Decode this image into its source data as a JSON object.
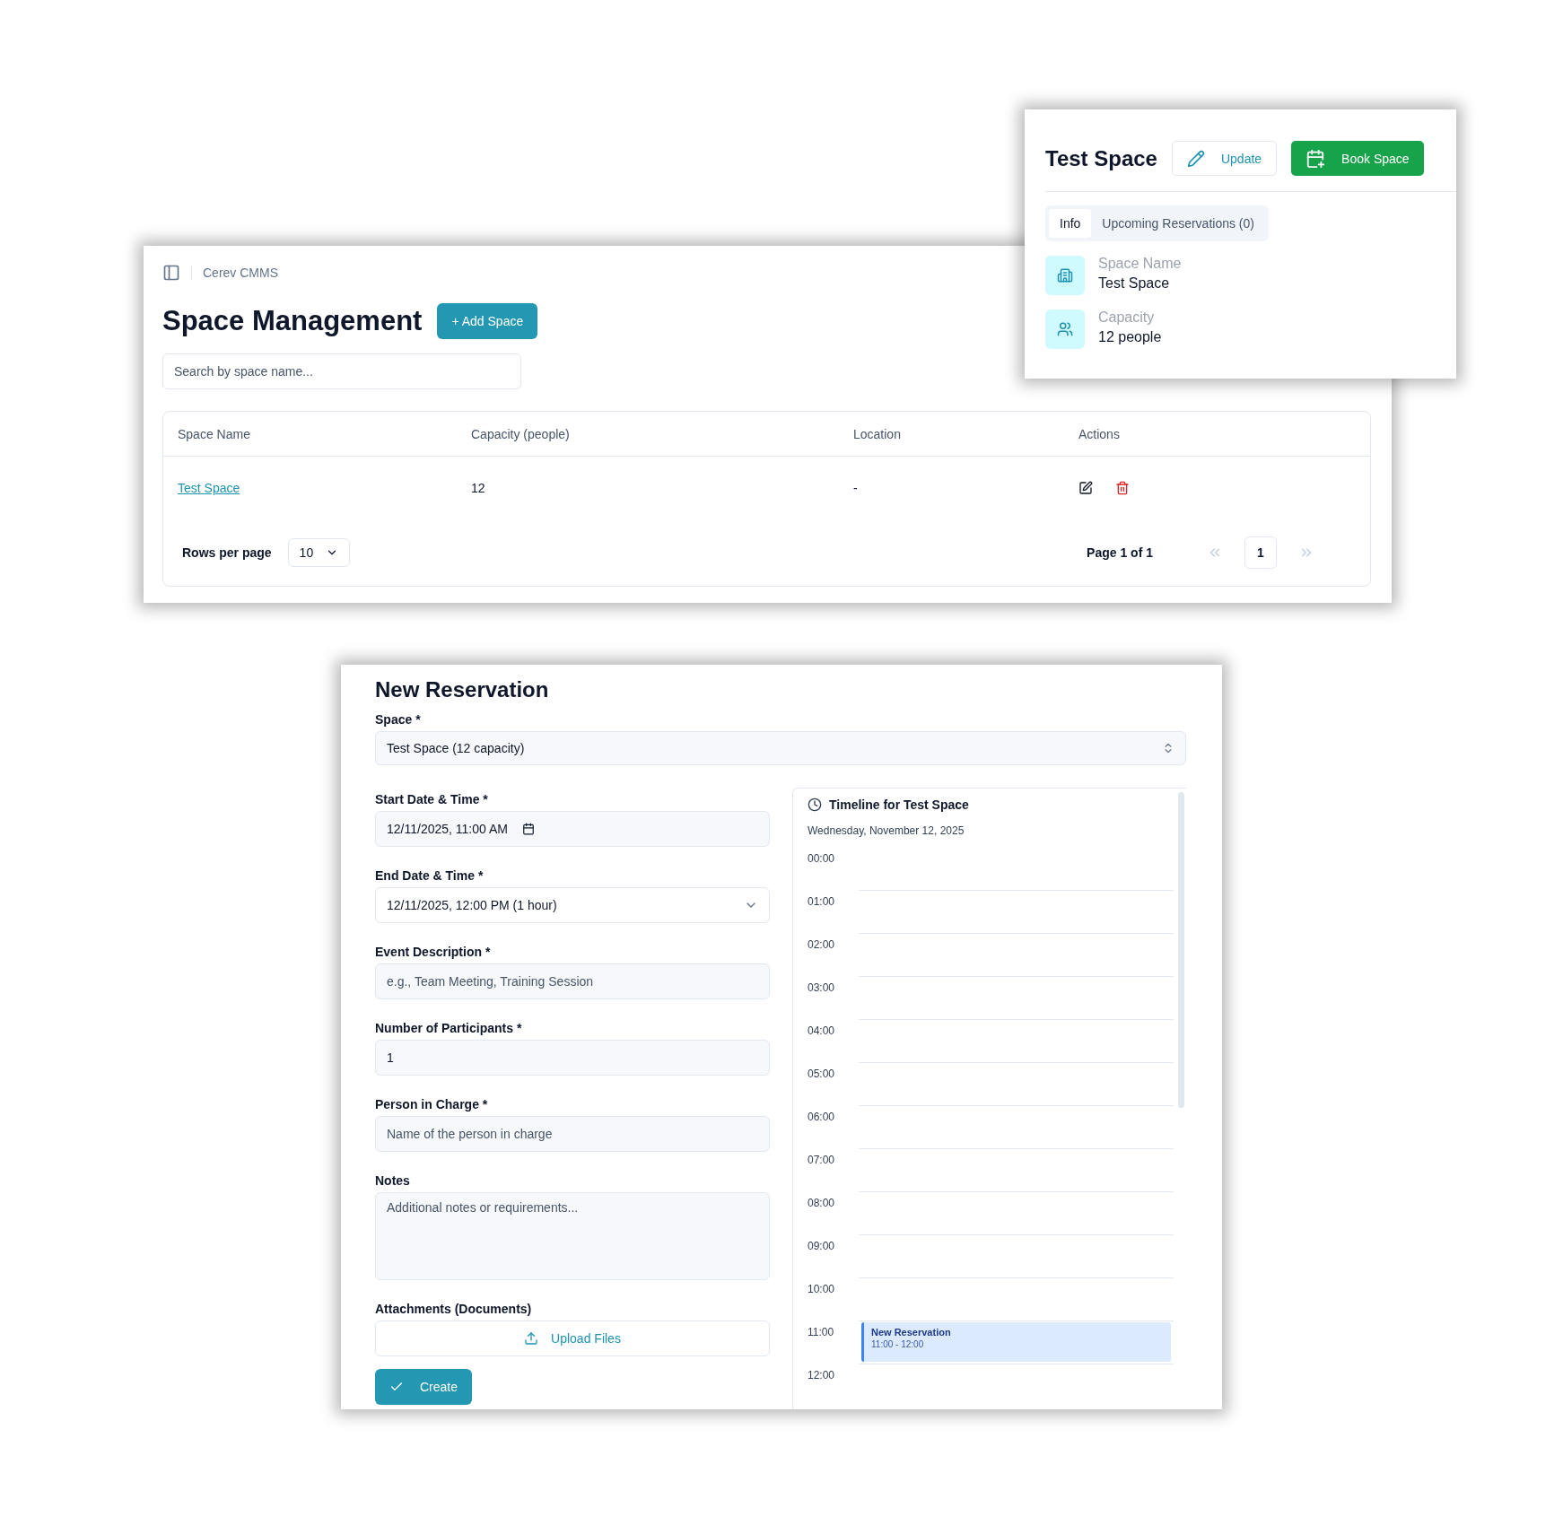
{
  "space_list": {
    "breadcrumb": "Cerev CMMS",
    "title": "Space Management",
    "add_button": "+ Add Space",
    "search": {
      "placeholder": "Search by space name..."
    },
    "table": {
      "columns": [
        "Space Name",
        "Capacity (people)",
        "Location",
        "Actions"
      ],
      "rows": [
        {
          "cells": [
            "Test Space",
            "12",
            "-"
          ]
        }
      ]
    },
    "pagination": {
      "rows_per_page_label": "Rows per page",
      "rows_per_page_value": "10",
      "page_label": "Page 1 of 1",
      "current_page": "1",
      "nav": [
        {
          "kind": "first",
          "disabled": true
        },
        {
          "kind": "last",
          "disabled": true
        }
      ]
    }
  },
  "space_detail": {
    "title": "Test Space",
    "buttons": [
      {
        "kind": "update",
        "label": "Update"
      },
      {
        "kind": "book",
        "label": "Book Space"
      }
    ],
    "tabs": [
      {
        "label": "Info",
        "selected": true
      },
      {
        "label": "Upcoming Reservations (0)",
        "selected": false
      }
    ],
    "fields": [
      {
        "label": "Space Name",
        "value": "Test Space"
      },
      {
        "label": "Capacity",
        "value": "12 people"
      }
    ]
  },
  "reservation_form": {
    "title": "New Reservation",
    "space": {
      "label": "Space *",
      "value": "Test Space (12 capacity)"
    },
    "fields": [
      {
        "kind": "datetime",
        "label": "Start Date & Time *",
        "value": "12/11/2025, 11:00 AM"
      },
      {
        "kind": "select",
        "label": "End Date & Time *",
        "value": "12/11/2025, 12:00 PM (1 hour)"
      },
      {
        "kind": "text",
        "label": "Event Description *",
        "placeholder": "e.g., Team Meeting, Training Session"
      },
      {
        "kind": "text",
        "label": "Number of Participants *",
        "value": "1"
      },
      {
        "kind": "text",
        "label": "Person in Charge *",
        "placeholder": "Name of the person in charge"
      },
      {
        "kind": "textarea",
        "label": "Notes",
        "placeholder": "Additional notes or requirements..."
      },
      {
        "kind": "upload",
        "label": "Attachments (Documents)",
        "button": "Upload Files"
      }
    ],
    "submit": "Create",
    "timeline": {
      "title": "Timeline for Test Space",
      "date": "Wednesday, November 12, 2025",
      "hours": [
        {
          "label": "00:00"
        },
        {
          "label": "01:00"
        },
        {
          "label": "02:00"
        },
        {
          "label": "03:00"
        },
        {
          "label": "04:00"
        },
        {
          "label": "05:00"
        },
        {
          "label": "06:00"
        },
        {
          "label": "07:00"
        },
        {
          "label": "08:00"
        },
        {
          "label": "09:00"
        },
        {
          "label": "10:00"
        },
        {
          "label": "11:00",
          "events": [
            {
              "title": "New Reservation",
              "time": "11:00 - 12:00"
            }
          ]
        },
        {
          "label": "12:00"
        }
      ]
    }
  }
}
